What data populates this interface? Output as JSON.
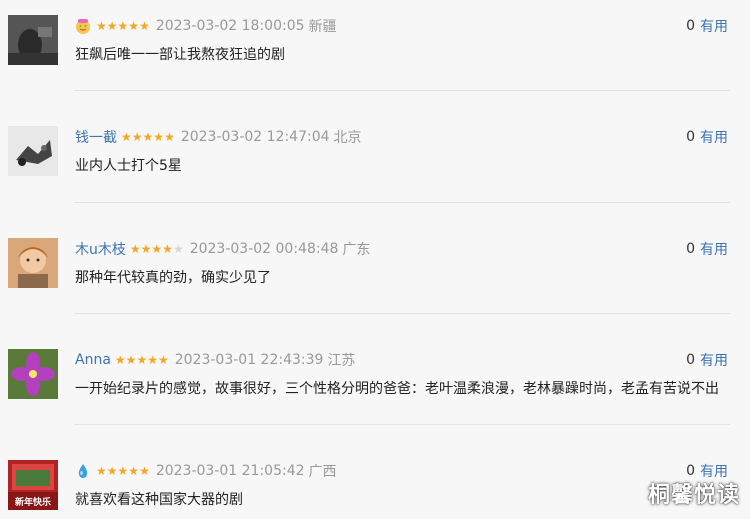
{
  "comments": [
    {
      "name": "",
      "name_icon": "face-emoji-icon",
      "rating": 5,
      "time": "2023-03-02 18:00:05",
      "location": "新疆",
      "content": "狂飙后唯一一部让我熬夜狂追的剧",
      "votes": "0",
      "vote_label": "有用"
    },
    {
      "name": "钱一截",
      "rating": 5,
      "time": "2023-03-02 12:47:04",
      "location": "北京",
      "content": "业内人士打个5星",
      "votes": "0",
      "vote_label": "有用"
    },
    {
      "name": "木u木枝",
      "rating": 4,
      "time": "2023-03-02 00:48:48",
      "location": "广东",
      "content": "那种年代较真的劲，确实少见了",
      "votes": "0",
      "vote_label": "有用"
    },
    {
      "name": "Anna",
      "rating": 5,
      "time": "2023-03-01 22:43:39",
      "location": "江苏",
      "content": "一开始纪录片的感觉，故事很好，三个性格分明的爸爸：老叶温柔浪漫，老林暴躁时尚，老孟有苦说不出",
      "votes": "0",
      "vote_label": "有用"
    },
    {
      "name": "",
      "name_icon": "water-drop-icon",
      "rating": 5,
      "time": "2023-03-01 21:05:42",
      "location": "广西",
      "content": "就喜欢看这种国家大器的剧",
      "votes": "0",
      "vote_label": "有用"
    }
  ],
  "avatar5_text": "新年快乐",
  "watermark": "桐馨悦读",
  "colors": {
    "link": "#3f73b0",
    "star": "#f6a623",
    "meta": "#999999"
  }
}
